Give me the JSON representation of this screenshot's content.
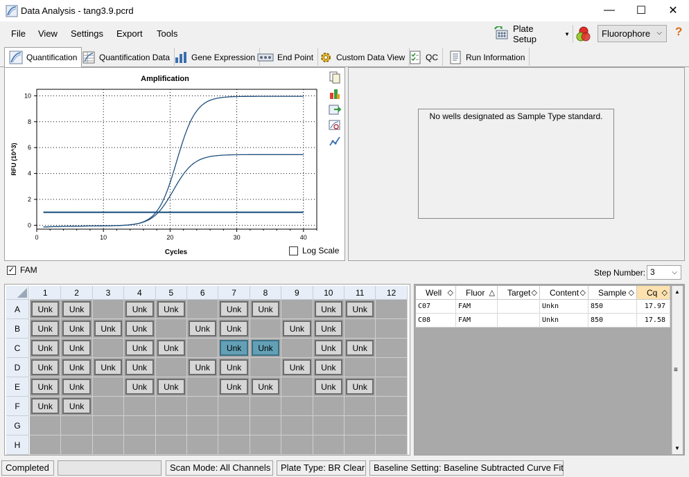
{
  "window": {
    "title": "Data Analysis - tang3.9.pcrd",
    "minimize": "—",
    "maximize": "☐",
    "close": "✕"
  },
  "menu": [
    "File",
    "View",
    "Settings",
    "Export",
    "Tools"
  ],
  "toolbar": {
    "plate_setup": "Plate Setup",
    "fluorophore": "Fluorophore",
    "help": "?"
  },
  "tabs": [
    "Quantification",
    "Quantification Data",
    "Gene Expression",
    "End Point",
    "Custom Data View",
    "QC",
    "Run Information"
  ],
  "chart": {
    "title": "Amplification",
    "ylabel": "RFU (10^3)",
    "xlabel": "Cycles",
    "log_scale_label": "Log Scale",
    "yticks": [
      "10",
      "8",
      "6",
      "4",
      "2",
      "0"
    ],
    "xticks": [
      "0",
      "10",
      "20",
      "30",
      "40"
    ]
  },
  "chart_data": {
    "type": "line",
    "title": "Amplification",
    "xlabel": "Cycles",
    "ylabel": "RFU (10^3)",
    "xlim": [
      0,
      42
    ],
    "ylim": [
      -0.3,
      10.5
    ],
    "threshold": 1.0,
    "grid": true,
    "series": [
      {
        "plateau": 10.0,
        "midpoint": 21.0,
        "slope": 1.45,
        "start": 1,
        "end": 40
      },
      {
        "plateau": 5.5,
        "midpoint": 20.5,
        "slope": 1.55,
        "start": 1,
        "end": 40
      }
    ]
  },
  "standards_message": "No wells designated as Sample Type standard.",
  "fam_label": "FAM",
  "step_label": "Step Number:",
  "step_value": "3",
  "plate": {
    "cols": [
      "1",
      "2",
      "3",
      "4",
      "5",
      "6",
      "7",
      "8",
      "9",
      "10",
      "11",
      "12"
    ],
    "rows": [
      "A",
      "B",
      "C",
      "D",
      "E",
      "F",
      "G",
      "H"
    ],
    "well_label": "Unk",
    "wells": {
      "A": [
        1,
        2,
        4,
        5,
        7,
        8,
        10,
        11
      ],
      "B": [
        1,
        2,
        3,
        4,
        6,
        7,
        9,
        10
      ],
      "C": [
        1,
        2,
        4,
        5,
        7,
        8,
        10,
        11
      ],
      "D": [
        1,
        2,
        3,
        4,
        6,
        7,
        9,
        10
      ],
      "E": [
        1,
        2,
        4,
        5,
        7,
        8,
        10,
        11
      ],
      "F": [
        1,
        2
      ],
      "G": [],
      "H": []
    },
    "selected": [
      "C7",
      "C8"
    ]
  },
  "grid": {
    "headers": [
      "Well",
      "Fluor",
      "Target",
      "Content",
      "Sample",
      "Cq"
    ],
    "rows": [
      [
        "C07",
        "FAM",
        "",
        "Unkn",
        "850",
        "17.97"
      ],
      [
        "C08",
        "FAM",
        "",
        "Unkn",
        "850",
        "17.58"
      ]
    ]
  },
  "status": {
    "state": "Completed",
    "scan_mode": "Scan Mode: All Channels",
    "plate_type": "Plate Type: BR Clear",
    "baseline_setting": "Baseline Setting: Baseline Subtracted Curve Fit"
  }
}
